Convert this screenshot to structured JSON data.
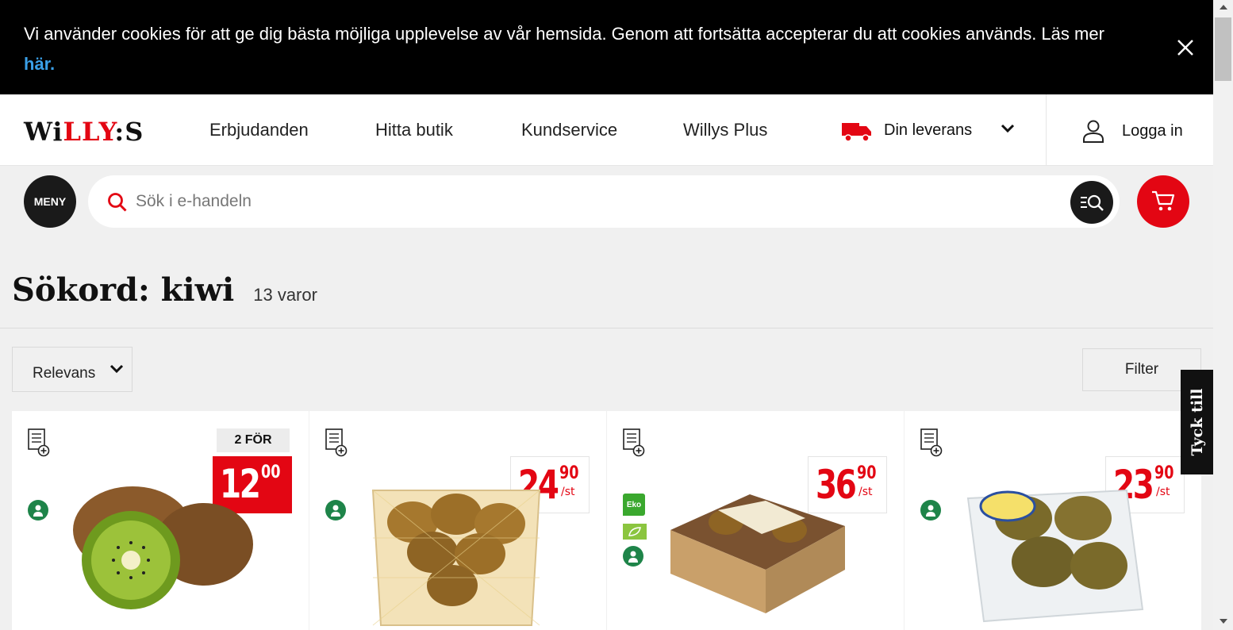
{
  "cookie_banner": {
    "text": "Vi använder cookies för att ge dig bästa möjliga upplevelse av vår hemsida. Genom att fortsätta accepterar du att cookies används. Läs mer ",
    "link_label": "här."
  },
  "header": {
    "logo": {
      "part1": "Wi",
      "part2": "LLY",
      "part3": ":S"
    },
    "nav": [
      "Erbjudanden",
      "Hitta butik",
      "Kundservice",
      "Willys Plus"
    ],
    "delivery_label": "Din leverans",
    "login_label": "Logga in"
  },
  "search": {
    "menu_label": "MENY",
    "placeholder": "Sök i e-handeln"
  },
  "results": {
    "title": "Sökord: kiwi",
    "count": "13 varor",
    "sort_label": "Relevans",
    "filter_label": "Filter"
  },
  "products": [
    {
      "deal": "2 FÖR",
      "price_int": "12",
      "price_dec": "00",
      "unit": "",
      "style": "red",
      "image": "kiwi-halved"
    },
    {
      "deal": "",
      "price_int": "24",
      "price_dec": "90",
      "unit": "/st",
      "style": "white",
      "image": "kiwi-basket"
    },
    {
      "deal": "",
      "price_int": "36",
      "price_dec": "90",
      "unit": "/st",
      "style": "white",
      "image": "kiwi-eko-tray",
      "eko_label": "Eko"
    },
    {
      "deal": "",
      "price_int": "23",
      "price_dec": "90",
      "unit": "/st",
      "style": "white",
      "image": "kiwi-pack"
    }
  ],
  "feedback_tab": "Tyck till",
  "colors": {
    "brand_red": "#e30613",
    "link_blue": "#3aa0e8",
    "dark": "#1a1a1a",
    "eco_green": "#3aa82e",
    "fav_green": "#1e8449"
  }
}
